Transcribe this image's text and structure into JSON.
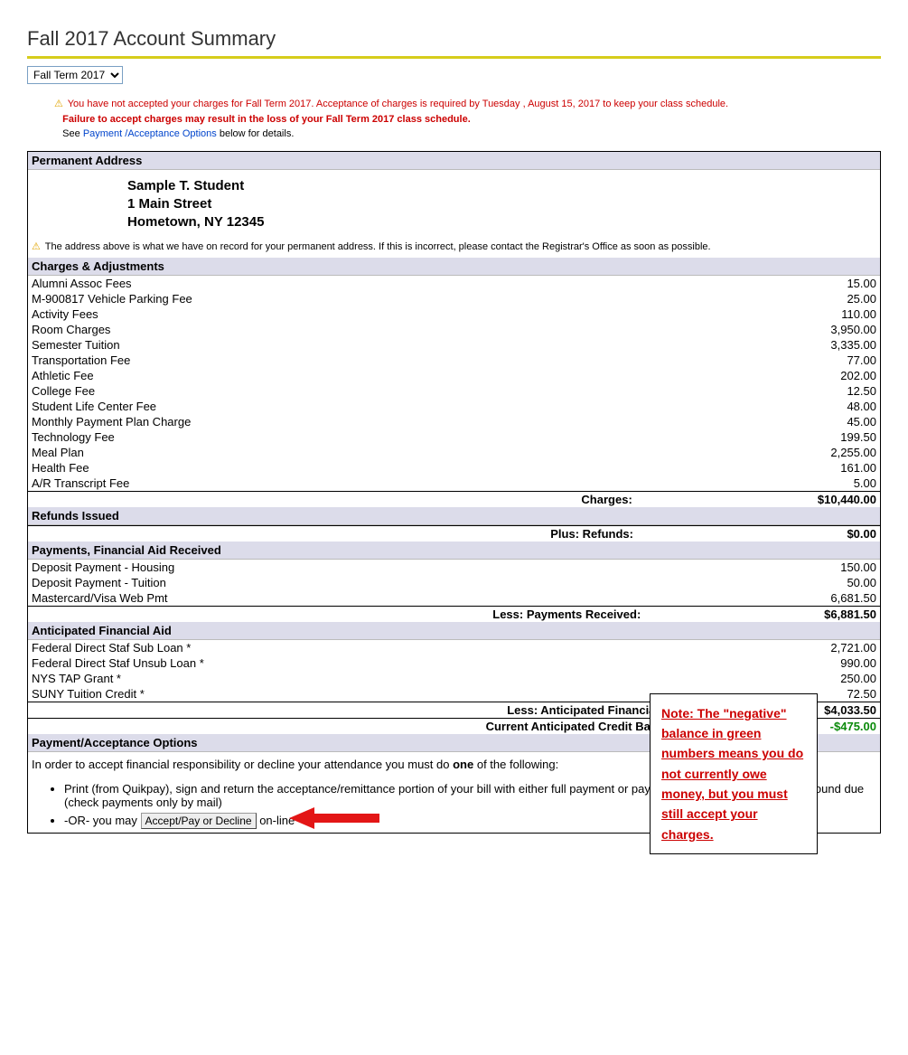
{
  "page_title": "Fall 2017 Account Summary",
  "term_options": [
    "Fall Term 2017"
  ],
  "term_selected": "Fall Term 2017",
  "warnings": {
    "line1": "You have not accepted your charges for Fall Term 2017. Acceptance of charges is required by Tuesday , August 15, 2017 to keep your class schedule.",
    "line2": "Failure to accept charges may result in the loss of your Fall Term 2017 class schedule.",
    "line3_pre": "See ",
    "line3_link": "Payment /Acceptance Options",
    "line3_post": " below for details."
  },
  "sections": {
    "address_header": "Permanent Address",
    "charges_header": "Charges & Adjustments",
    "refunds_header": "Refunds Issued",
    "payments_header": "Payments, Financial Aid Received",
    "anticipated_header": "Anticipated Financial Aid",
    "options_header": "Payment/Acceptance Options"
  },
  "address": {
    "name": "Sample T. Student",
    "street": "1 Main Street",
    "citystate": "Hometown, NY 12345",
    "warn": "The address above is what we have on record for your permanent address. If this is incorrect, please contact the Registrar's Office as soon as possible."
  },
  "charges": [
    {
      "label": "Alumni Assoc Fees",
      "amount": "15.00"
    },
    {
      "label": "M-900817 Vehicle Parking Fee",
      "amount": "25.00"
    },
    {
      "label": "Activity Fees",
      "amount": "110.00"
    },
    {
      "label": "Room Charges",
      "amount": "3,950.00"
    },
    {
      "label": "Semester Tuition",
      "amount": "3,335.00"
    },
    {
      "label": "Transportation Fee",
      "amount": "77.00"
    },
    {
      "label": "Athletic Fee",
      "amount": "202.00"
    },
    {
      "label": "College Fee",
      "amount": "12.50"
    },
    {
      "label": "Student Life Center Fee",
      "amount": "48.00"
    },
    {
      "label": "Monthly Payment Plan Charge",
      "amount": "45.00"
    },
    {
      "label": "Technology Fee",
      "amount": "199.50"
    },
    {
      "label": "Meal Plan",
      "amount": "2,255.00"
    },
    {
      "label": "Health Fee",
      "amount": "161.00"
    },
    {
      "label": "A/R Transcript Fee",
      "amount": "5.00"
    }
  ],
  "charges_total_label": "Charges:",
  "charges_total": "$10,440.00",
  "refunds_total_label": "Plus: Refunds:",
  "refunds_total": "$0.00",
  "payments": [
    {
      "label": "Deposit Payment - Housing",
      "amount": "150.00"
    },
    {
      "label": "Deposit Payment - Tuition",
      "amount": "50.00"
    },
    {
      "label": "Mastercard/Visa Web Pmt",
      "amount": "6,681.50"
    }
  ],
  "payments_total_label": "Less: Payments Received:",
  "payments_total": "$6,881.50",
  "anticipated": [
    {
      "label": "Federal Direct Staf Sub Loan *",
      "amount": "2,721.00"
    },
    {
      "label": "Federal Direct Staf Unsub Loan *",
      "amount": "990.00"
    },
    {
      "label": "NYS TAP Grant *",
      "amount": "250.00"
    },
    {
      "label": "SUNY Tuition Credit *",
      "amount": "72.50"
    }
  ],
  "anticipated_total_label": "Less: Anticipated Financial Aid:",
  "anticipated_total": "$4,033.50",
  "balance_label": "Current Anticipated Credit Balance:",
  "balance_value": "-$475.00",
  "options": {
    "intro_pre": "In order to accept financial responsibility or decline your attendance you must do ",
    "intro_bold": "one",
    "intro_post": " of the following:",
    "bullet1": "Print (from Quikpay), sign and return the acceptance/remittance portion of your bill with either full payment or payment plan amount/minimum amound due (check payments only by mail)",
    "bullet2_pre": "-OR- you may ",
    "bullet2_btn": "Accept/Pay or Decline",
    "bullet2_post": " on-line"
  },
  "note_box": "Note:  The \"negative\" balance in green numbers means you do not currently owe money, but you must still accept your charges."
}
